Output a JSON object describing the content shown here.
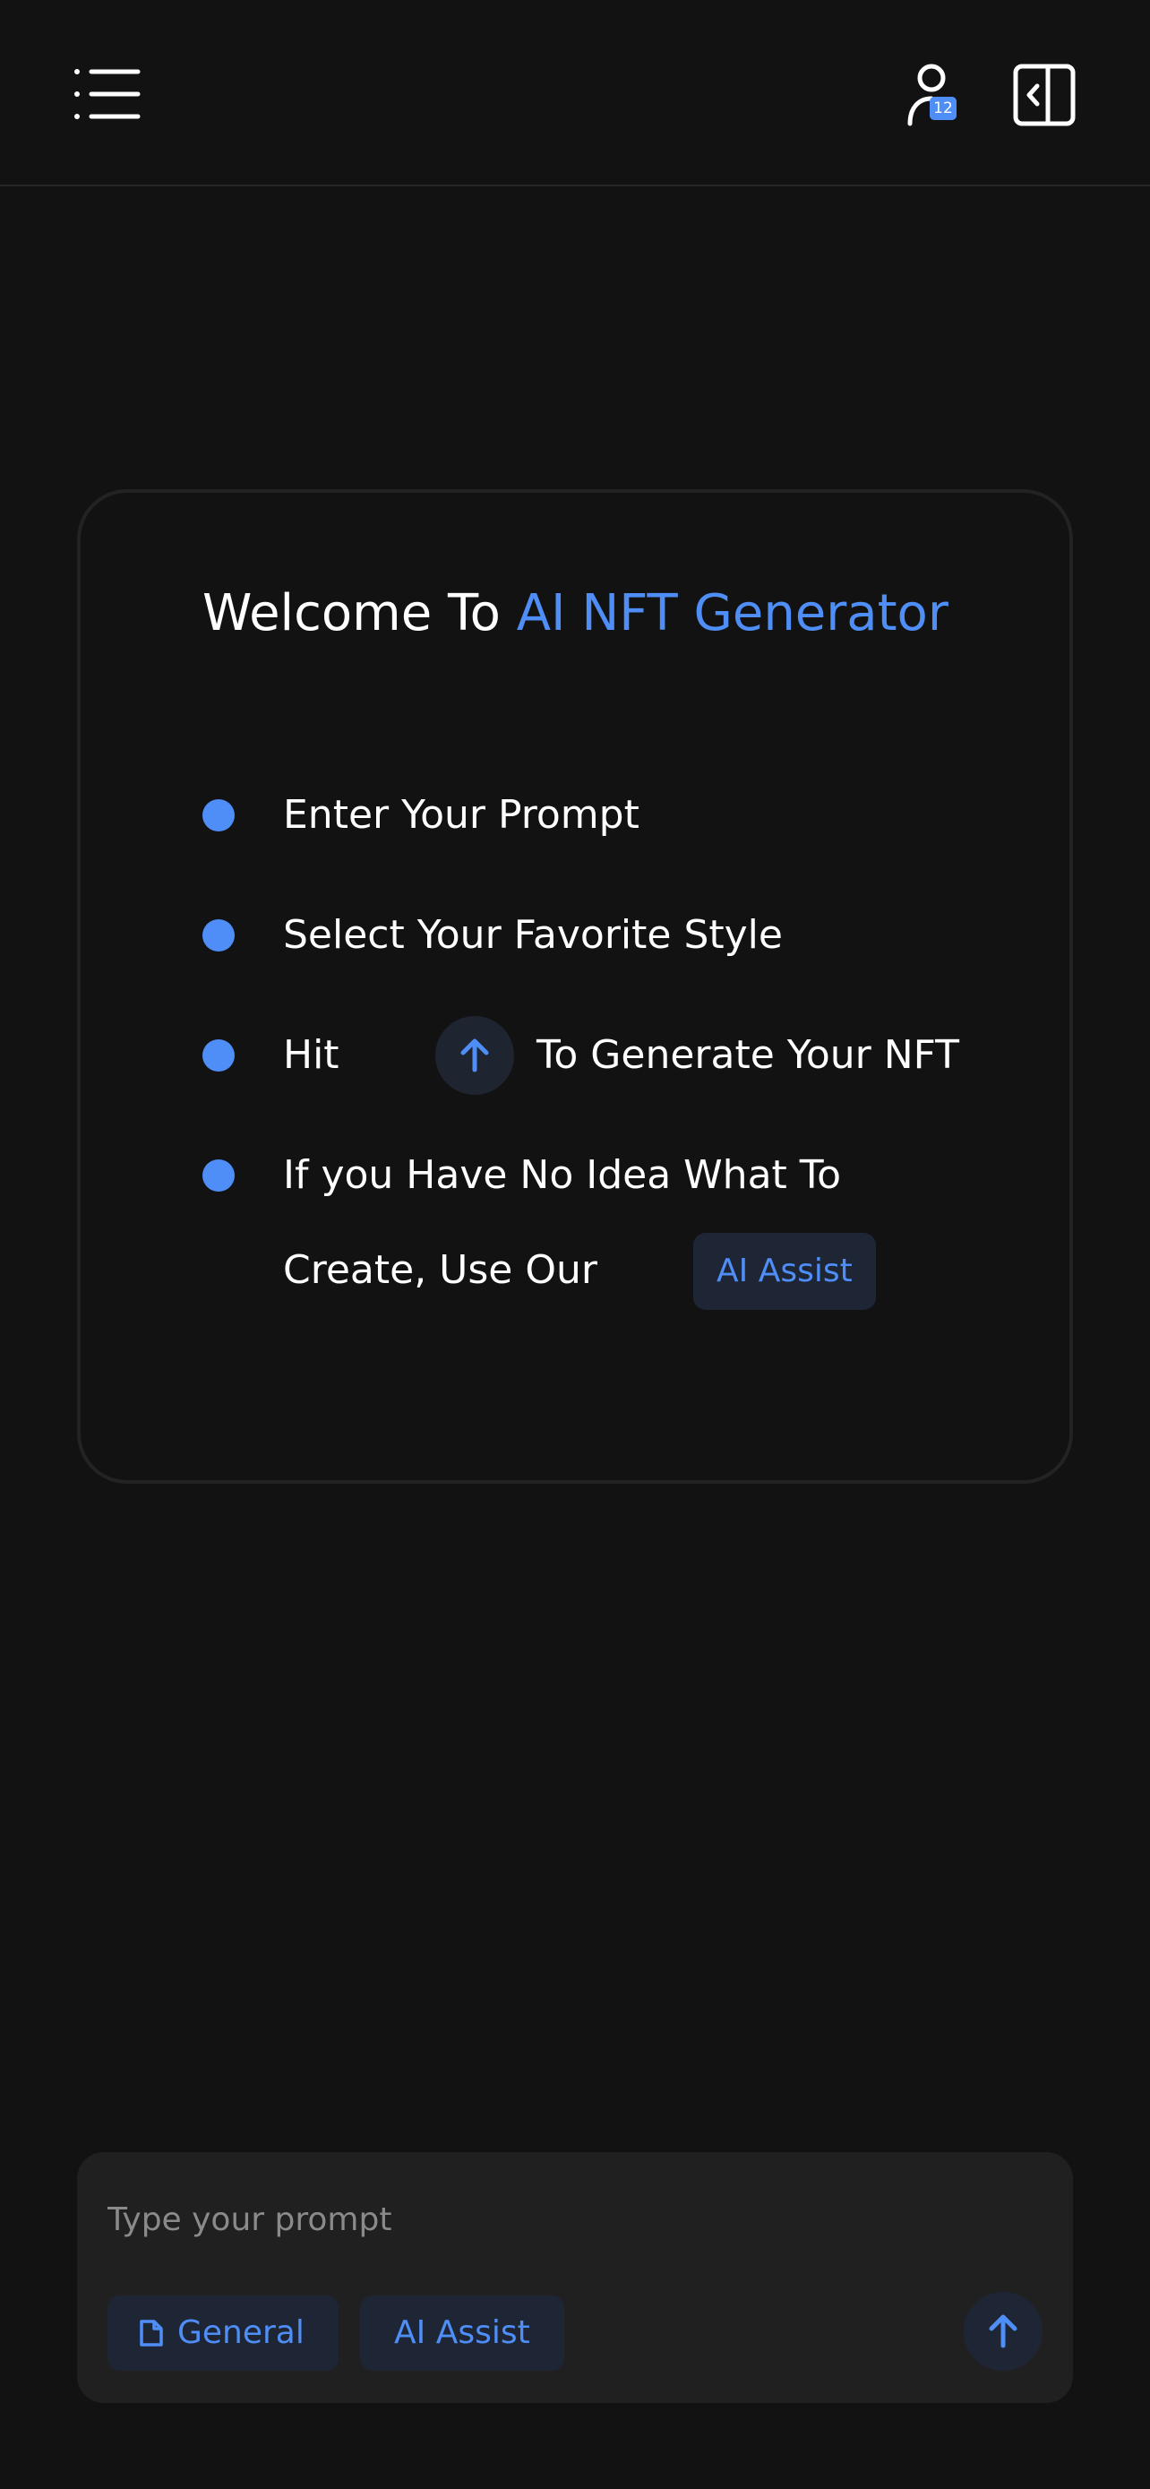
{
  "header": {
    "menu_icon": "menu-icon",
    "user_icon": "user-icon",
    "user_badge_count": "12",
    "panel_icon": "sidebar-collapse-icon"
  },
  "welcome": {
    "title_prefix": "Welcome To ",
    "title_accent": "AI NFT Generator",
    "steps": [
      {
        "text": "Enter Your Prompt"
      },
      {
        "text": "Select Your Favorite Style"
      },
      {
        "text_before": "Hit",
        "text_after": "To Generate Your NFT",
        "icon": "arrow-up-icon"
      },
      {
        "line1": "If you Have No Idea What To",
        "line2": "Create, Use Our",
        "chip": "AI Assist"
      }
    ]
  },
  "prompt": {
    "placeholder": "Type your prompt",
    "value": "",
    "general_label": "General",
    "general_icon": "document-icon",
    "assist_label": "AI Assist",
    "send_icon": "arrow-up-icon"
  },
  "colors": {
    "background": "#121212",
    "accent": "#4f8ef7",
    "card_border": "#232323",
    "chip_background": "#1e2636",
    "prompt_background": "#202020"
  }
}
